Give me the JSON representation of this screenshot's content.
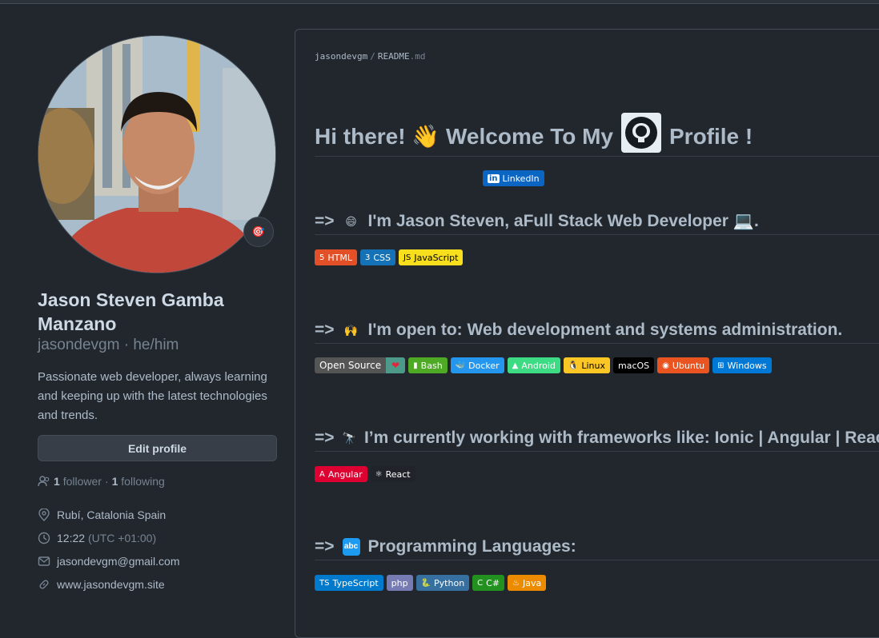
{
  "profile": {
    "fullname": "Jason Steven Gamba Manzano",
    "handle": "jasondevgm · he/him",
    "bio": "Passionate web developer, always learning and keeping up with the latest technologies and trends.",
    "edit_label": "Edit profile",
    "followers_count": "1",
    "followers_label": "follower",
    "following_count": "1",
    "following_label": "following",
    "location": "Rubí, Catalonia Spain",
    "time": "12:22",
    "timezone": "(UTC +01:00)",
    "email": "jasondevgm@gmail.com",
    "website": "www.jasondevgm.site",
    "status_emoji": "🎯"
  },
  "readme": {
    "crumb_user": "jasondevgm",
    "crumb_sep": "/",
    "crumb_file": "README",
    "crumb_ext": ".md",
    "title_pre": "Hi there! 👋 Welcome To My",
    "title_post": "Profile !",
    "linkedin": "LinkedIn",
    "sections": [
      {
        "arrow": "=>",
        "emoji": "😄",
        "text": "I'm Jason Steven, aFull Stack Web Developer 💻."
      },
      {
        "arrow": "=>",
        "emoji": "🙌",
        "text": "I'm open to: Web development and systems administration."
      },
      {
        "arrow": "=>",
        "emoji": "🔭",
        "text": "I’m currently working with frameworks like: Ionic | Angular | React"
      },
      {
        "arrow": "=>",
        "emoji": "🔤",
        "text": "Programming Languages:"
      }
    ],
    "badges_web": [
      {
        "label": "HTML",
        "icon": "5",
        "color": "#e34f26"
      },
      {
        "label": "CSS",
        "icon": "3",
        "color": "#1572b6"
      },
      {
        "label": "JavaScript",
        "icon": "JS",
        "color": "#f7df1e"
      }
    ],
    "open_source": {
      "left": "Open Source",
      "right": "❤"
    },
    "badges_tools": [
      {
        "label": "Bash",
        "icon": "▮",
        "color": "#4eaa25"
      },
      {
        "label": "Docker",
        "icon": "🐳",
        "color": "#2496ed"
      },
      {
        "label": "Android",
        "icon": "▲",
        "color": "#3ddc84"
      },
      {
        "label": "Linux",
        "icon": "🐧",
        "color": "#fcc624"
      },
      {
        "label": "macOS",
        "icon": "",
        "color": "#000000"
      },
      {
        "label": "Ubuntu",
        "icon": "◉",
        "color": "#e95420"
      },
      {
        "label": "Windows",
        "icon": "⊞",
        "color": "#0078d6"
      }
    ],
    "badges_frameworks": [
      {
        "label": "Angular",
        "icon": "A",
        "color": "#dd0031"
      },
      {
        "label": "React",
        "icon": "⚛",
        "color": "#20232a"
      }
    ],
    "badges_languages": [
      {
        "label": "TypeScript",
        "icon": "TS",
        "color": "#007acc"
      },
      {
        "label": "php",
        "icon": "",
        "color": "#777bb4"
      },
      {
        "label": "Python",
        "icon": "🐍",
        "color": "#3670a0"
      },
      {
        "label": "C#",
        "icon": "C",
        "color": "#239120"
      },
      {
        "label": "Java",
        "icon": "♨",
        "color": "#ed8b00"
      }
    ]
  }
}
